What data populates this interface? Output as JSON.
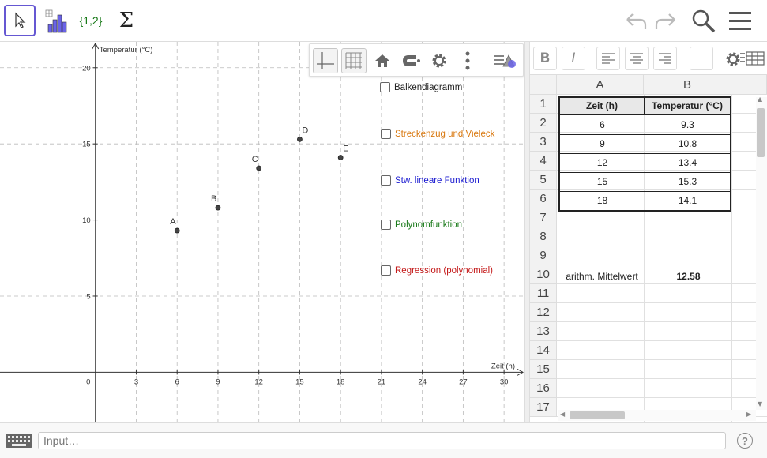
{
  "toolbar": {
    "tools": [
      {
        "name": "move-tool",
        "icon": "arrow-cursor-icon"
      },
      {
        "name": "bar-chart-tool",
        "icon": "bar-chart-icon"
      },
      {
        "name": "list-tool",
        "label": "{1,2}"
      },
      {
        "name": "sum-tool",
        "label": "Σ"
      }
    ],
    "undo": "undo-icon",
    "redo": "redo-icon",
    "search": "search-icon",
    "menu": "menu-icon"
  },
  "graphics": {
    "ylabel": "Temperatur (°C)",
    "xlabel": "Zeit (h)",
    "checkboxes": [
      {
        "label": "Balkendiagramm",
        "color": "#222222"
      },
      {
        "label": "Streckenzug und Vieleck",
        "color": "#d9780f"
      },
      {
        "label": "Stw. lineare Funktion",
        "color": "#1a1ad0"
      },
      {
        "label": "Polynomfunktion",
        "color": "#1a7a1a"
      },
      {
        "label": "Regression (polynomial)",
        "color": "#c41a1a"
      }
    ]
  },
  "chart_data": {
    "type": "scatter",
    "xlabel": "Zeit (h)",
    "ylabel": "Temperatur (°C)",
    "xlim": [
      -7,
      31.5
    ],
    "ylim": [
      -3.3,
      21.7
    ],
    "x_ticks": [
      0,
      3,
      6,
      9,
      12,
      15,
      18,
      21,
      24,
      27,
      30
    ],
    "y_ticks": [
      5,
      10,
      15,
      20
    ],
    "grid": true,
    "points": [
      {
        "label": "A",
        "x": 6,
        "y": 9.3
      },
      {
        "label": "B",
        "x": 9,
        "y": 10.8
      },
      {
        "label": "C",
        "x": 12,
        "y": 13.4
      },
      {
        "label": "D",
        "x": 15,
        "y": 15.3
      },
      {
        "label": "E",
        "x": 18,
        "y": 14.1
      }
    ]
  },
  "spreadsheet": {
    "columns": [
      "A",
      "B"
    ],
    "rows": [
      "1",
      "2",
      "3",
      "4",
      "5",
      "6",
      "7",
      "8",
      "9",
      "10",
      "11",
      "12",
      "13",
      "14",
      "15",
      "16",
      "17"
    ],
    "header": {
      "a": "Zeit (h)",
      "b": "Temperatur (°C)"
    },
    "data": [
      {
        "a": "6",
        "b": "9.3"
      },
      {
        "a": "9",
        "b": "10.8"
      },
      {
        "a": "12",
        "b": "13.4"
      },
      {
        "a": "15",
        "b": "15.3"
      },
      {
        "a": "18",
        "b": "14.1"
      }
    ],
    "mean_label": "arithm. Mittelwert",
    "mean_value": "12.58"
  },
  "input": {
    "placeholder": "Input…"
  }
}
